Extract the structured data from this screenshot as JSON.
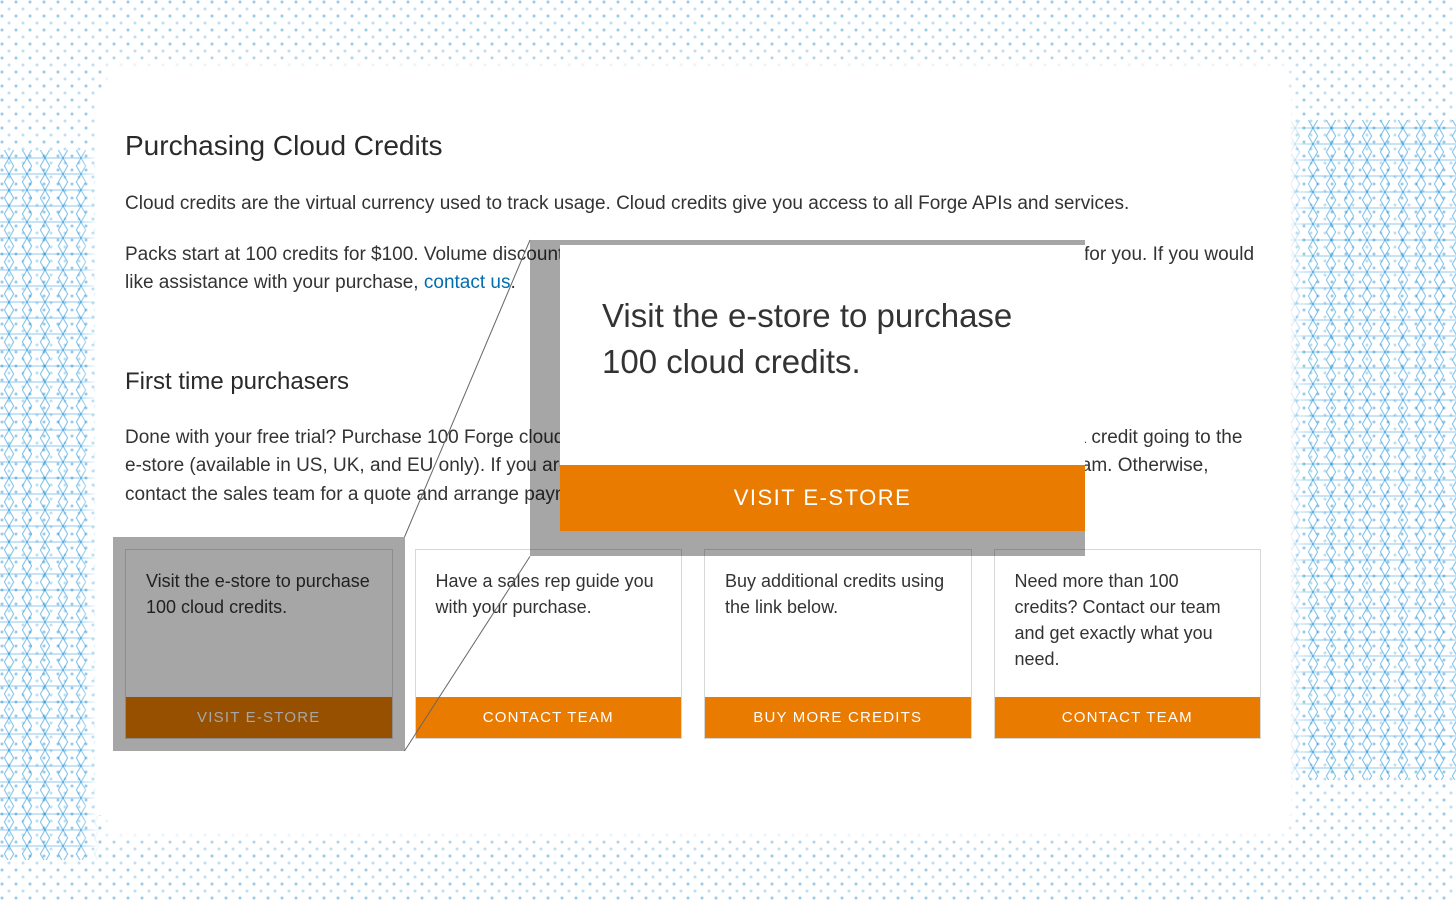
{
  "heading": "Purchasing Cloud Credits",
  "intro1": "Cloud credits are the virtual currency used to track usage. Cloud credits give you access to all Forge APIs and services.",
  "intro2a": "Packs start at 100 credits for $100.  Volume discounts are available. Choose the purchase method that works best for you.  If you would like assistance with your purchase, ",
  "intro2_link": "contact us",
  "subheading": "First time purchasers",
  "subintro": "Done with your free trial? Purchase 100 Forge cloud credits to get started. Cloud credits can be purchased using a credit going to the e-store (available in US, UK, and EU only). If you are interested in applying volume discounts, contact the sales team. Otherwise, contact the sales team for a quote and arrange payment via purchase order.",
  "cards": [
    {
      "body": "Visit the e-store to purchase 100 cloud credits.",
      "button": "VISIT E-STORE"
    },
    {
      "body": "Have a sales rep guide you with your purchase.",
      "button": "CONTACT TEAM"
    },
    {
      "body": "Buy additional credits using the link below.",
      "button": "BUY MORE CREDITS"
    },
    {
      "body": "Need more than 100 credits? Contact our team and get exactly what you need.",
      "button": "CONTACT TEAM"
    }
  ],
  "zoom": {
    "body": "Visit the e-store to purchase 100 cloud credits.",
    "button": "VISIT E-STORE"
  }
}
